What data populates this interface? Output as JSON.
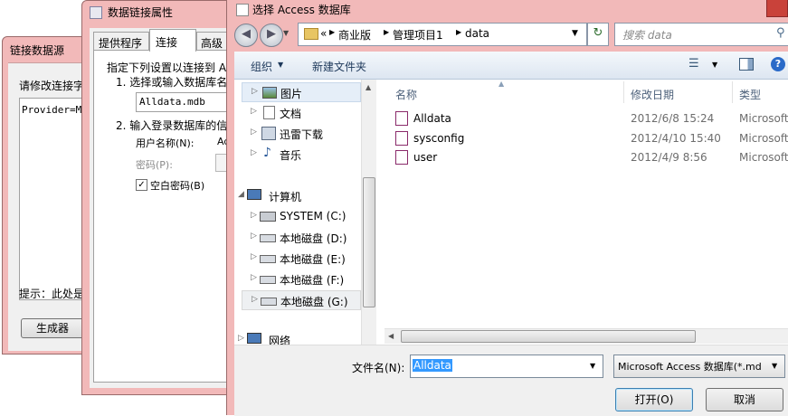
{
  "link_source_window": {
    "title": "链接数据源",
    "prompt": "请修改连接字",
    "connection_text": "Provider=Mi",
    "hint": "提示：此处是",
    "generator_button": "生成器"
  },
  "data_link_window": {
    "title": "数据链接属性",
    "tabs": [
      "提供程序",
      "连接",
      "高级"
    ],
    "instruction": "指定下列设置以连接到 A",
    "step1": "1. 选择或输入数据库名",
    "db_name_value": "Alldata.mdb",
    "step2": "2. 输入登录数据库的信",
    "username_label": "用户名称(N):",
    "username_value": "Ad",
    "password_label": "密码(P):",
    "blank_password_label": "空白密码(B)"
  },
  "file_dialog": {
    "title": "选择 Access 数据库",
    "breadcrumb": [
      "«",
      "商业版",
      "管理项目1",
      "data"
    ],
    "search_placeholder": "搜索 data",
    "toolbar": {
      "organize": "组织",
      "new_folder": "新建文件夹"
    },
    "nav_items": [
      {
        "label": "图片",
        "icon": "pictures-icon"
      },
      {
        "label": "文档",
        "icon": "documents-icon"
      },
      {
        "label": "迅雷下载",
        "icon": "download-icon"
      },
      {
        "label": "音乐",
        "icon": "music-icon"
      },
      {
        "label": "计算机",
        "icon": "computer-icon"
      },
      {
        "label": "SYSTEM (C:)",
        "icon": "system-drive-icon"
      },
      {
        "label": "本地磁盘 (D:)",
        "icon": "drive-icon"
      },
      {
        "label": "本地磁盘 (E:)",
        "icon": "drive-icon"
      },
      {
        "label": "本地磁盘 (F:)",
        "icon": "drive-icon"
      },
      {
        "label": "本地磁盘 (G:)",
        "icon": "drive-icon"
      },
      {
        "label": "网络",
        "icon": "network-icon"
      }
    ],
    "columns": [
      "名称",
      "修改日期",
      "类型"
    ],
    "files": [
      {
        "name": "Alldata",
        "date": "2012/6/8 15:24",
        "type": "Microsoft"
      },
      {
        "name": "sysconfig",
        "date": "2012/4/10 15:40",
        "type": "Microsoft"
      },
      {
        "name": "user",
        "date": "2012/4/9 8:56",
        "type": "Microsoft"
      }
    ],
    "filename_label": "文件名(N):",
    "filename_value": "Alldata",
    "filter_value": "Microsoft Access 数据库(*.md",
    "open_button": "打开(O)",
    "cancel_button": "取消"
  }
}
